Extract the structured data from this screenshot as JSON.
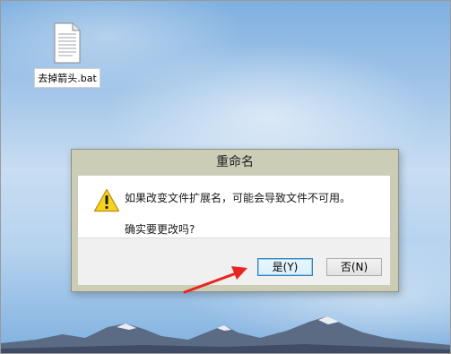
{
  "desktop": {
    "file_icon": "text-document-icon",
    "file_label": "去掉箭头.bat"
  },
  "dialog": {
    "title": "重命名",
    "icon": "warning-icon",
    "message_line1": "如果改变文件扩展名，可能会导致文件不可用。",
    "message_line2": "确实要更改吗?",
    "yes_label": "是(Y)",
    "no_label": "否(N)"
  },
  "annotation": {
    "arrow_color": "#e8261f",
    "arrow_icon": "red-arrow-annotation"
  }
}
